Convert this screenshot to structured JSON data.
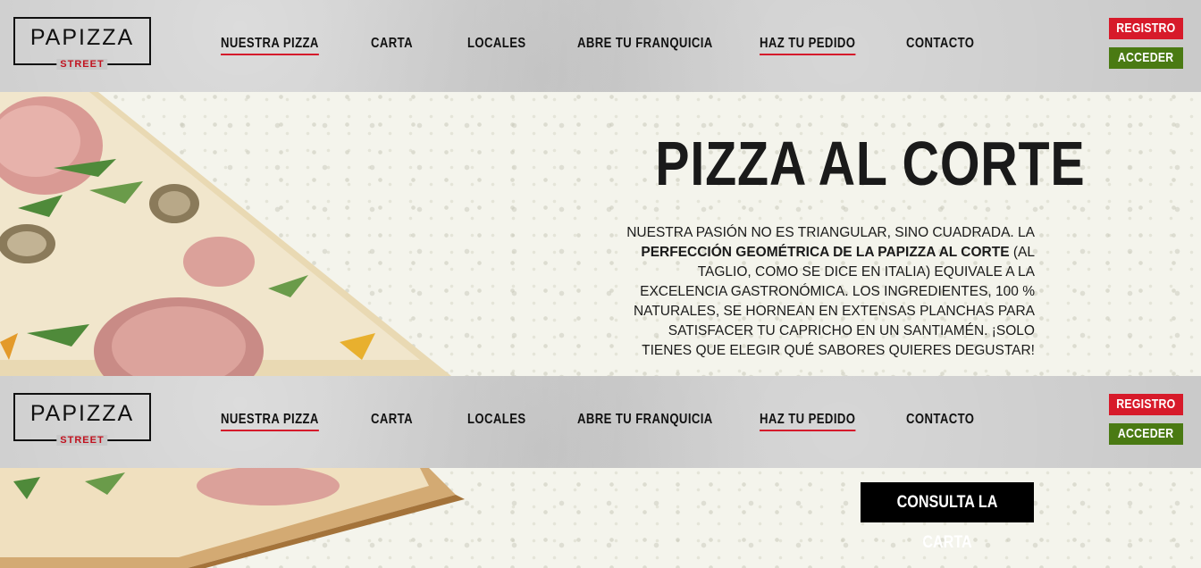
{
  "header": {
    "logo_main": "PAPIZZA",
    "logo_sub": "STREET",
    "nav": [
      {
        "label": "NUESTRA PIZZA"
      },
      {
        "label": "CARTA"
      },
      {
        "label": "LOCALES"
      },
      {
        "label": "ABRE TU FRANQUICIA"
      },
      {
        "label": "HAZ TU PEDIDO"
      },
      {
        "label": "CONTACTO"
      }
    ],
    "registro_label": "REGISTRO",
    "acceder_label": "ACCEDER"
  },
  "hero": {
    "title": "PIZZA AL CORTE",
    "desc_part1": "NUESTRA PASIÓN NO ES TRIANGULAR, SINO CUADRADA. LA ",
    "desc_bold": "PERFECCIÓN GEOMÉTRICA DE LA PAPIZZA AL CORTE",
    "desc_part2": " (AL TAGLIO, COMO SE DICE EN ITALIA) EQUIVALE A LA EXCELENCIA GASTRONÓMICA. LOS INGREDIENTES, 100 % NATURALES, SE HORNEAN EN EXTENSAS PLANCHAS PARA SATISFACER TU CAPRICHO EN UN SANTIAMÉN. ¡SOLO TIENES QUE ELEGIR QUÉ SABORES QUIERES DEGUSTAR!",
    "cta_label": "CONSULTA LA CARTA"
  },
  "colors": {
    "accent_red": "#d71a2a",
    "accent_green": "#4a7a13",
    "header_bg": "#c9c9c9"
  }
}
